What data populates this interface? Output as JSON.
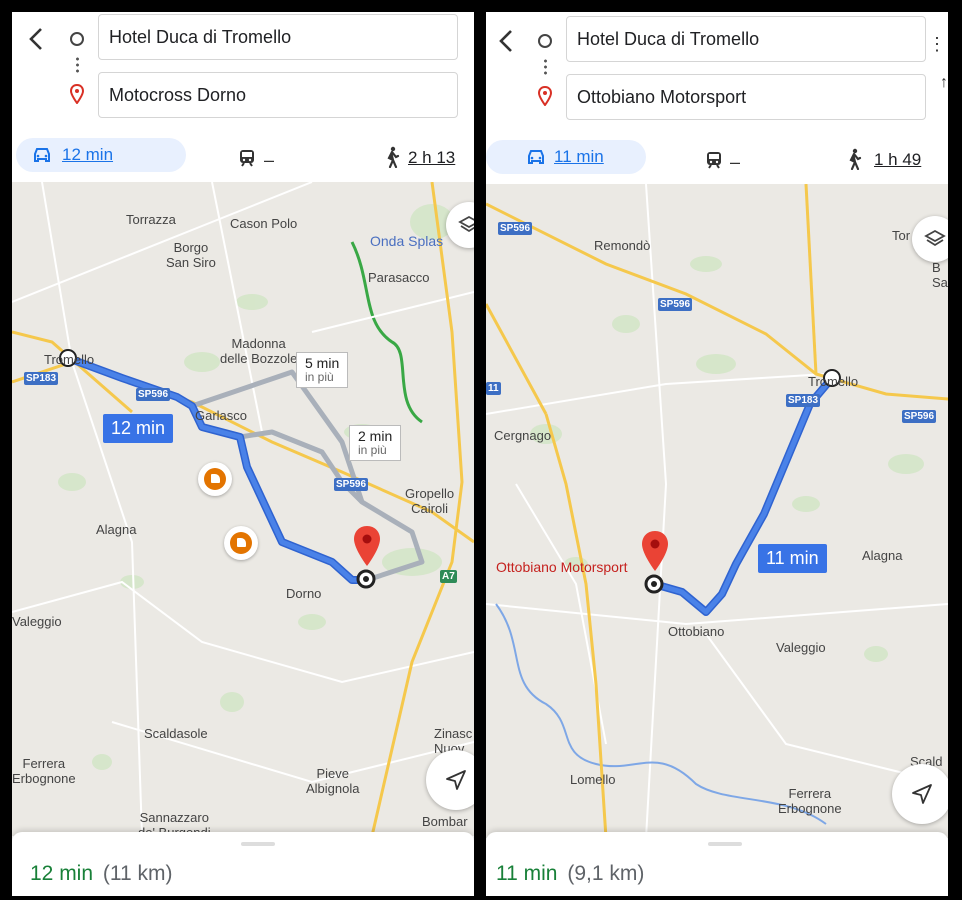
{
  "left": {
    "origin": "Hotel Duca di Tromello",
    "destination": "Motocross Dorno",
    "car_time": "12 min",
    "walk_time": "2 h 13",
    "transit_time": "–",
    "route_time": "12 min",
    "alt_routes": [
      {
        "time": "5 min",
        "note": "in più"
      },
      {
        "time": "2 min",
        "note": "in più"
      }
    ],
    "places": {
      "torrazza": "Torrazza",
      "cason_polo": "Cason Polo",
      "borgo": "Borgo\nSan Siro",
      "onda": "Onda Splas",
      "parasacco": "Parasacco",
      "madonna": "Madonna\ndelle Bozzole",
      "tromello": "Tromello",
      "garlasco": "Garlasco",
      "gropello": "Gropello\nCairoli",
      "alagna": "Alagna",
      "dorno": "Dorno",
      "valeggio": "Valeggio",
      "scaldasole": "Scaldasole",
      "ferrera": "Ferrera\nErbognone",
      "pieve": "Pieve\nAlbignola",
      "zinasco": "Zinasc\nNuov",
      "sannazzaro": "Sannazzaro\nde' Burgondi",
      "bombard": "Bombar"
    },
    "shields": {
      "sp183": "SP183",
      "sp596a": "SP596",
      "sp596b": "SP596",
      "a7": "A7"
    },
    "summary_time": "12 min",
    "summary_dist": "(11 km)"
  },
  "right": {
    "origin": "Hotel Duca di Tromello",
    "destination": "Ottobiano Motorsport",
    "car_time": "11 min",
    "walk_time": "1 h 49",
    "transit_time": "–",
    "route_time": "11 min",
    "places": {
      "remondo": "Remondò",
      "tor": "Tor",
      "bsa": "B\nSa",
      "tromello": "Tromello",
      "cergnago": "Cergnago",
      "alagna": "Alagna",
      "ottobiano": "Ottobiano",
      "valeggio": "Valeggio",
      "lomello": "Lomello",
      "ferrera": "Ferrera\nErbognone",
      "scald": "Scald",
      "dest_label": "Ottobiano Motorsport"
    },
    "shields": {
      "sp596a": "SP596",
      "sp596b": "SP596",
      "sp596c": "SP596",
      "sp183": "SP183",
      "edge": "11"
    },
    "summary_time": "11 min",
    "summary_dist": "(9,1 km)"
  },
  "colors": {
    "route": "#4a82e8",
    "alt_route": "#a9b0ba",
    "accent": "#1a73e8",
    "green": "#188038",
    "pin": "#ea4335"
  },
  "icons": [
    "back-arrow-icon",
    "car-icon",
    "train-icon",
    "walk-icon",
    "layers-icon",
    "navigation-arrow-icon",
    "map-pin-icon",
    "traffic-incident-icon"
  ]
}
